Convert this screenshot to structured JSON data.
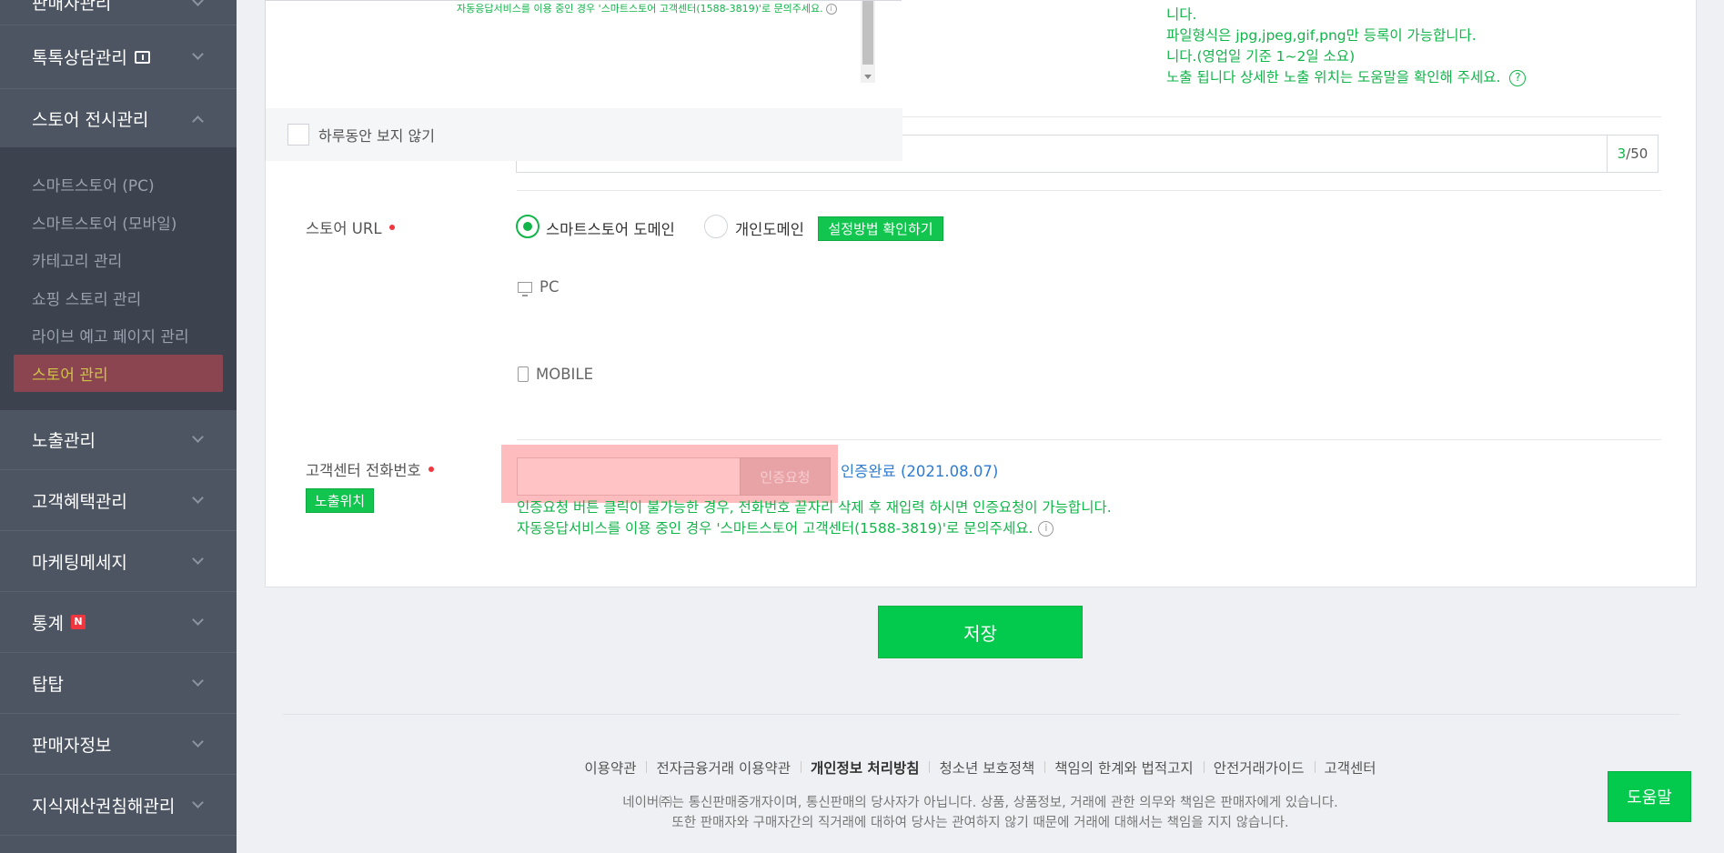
{
  "sidebar": {
    "top_partial": "판매자관리",
    "items": [
      {
        "label": "톡톡상담관리",
        "expanded": false
      },
      {
        "label": "스토어 전시관리",
        "expanded": true
      },
      {
        "label": "노출관리",
        "expanded": false
      },
      {
        "label": "고객혜택관리",
        "expanded": false
      },
      {
        "label": "마케팅메세지",
        "expanded": false
      },
      {
        "label": "통계",
        "badge": "N",
        "expanded": false
      },
      {
        "label": "탑탑",
        "expanded": false
      },
      {
        "label": "판매자정보",
        "expanded": false
      },
      {
        "label": "지식재산권침해관리",
        "expanded": false
      }
    ],
    "sub_items": [
      "스마트스토어 (PC)",
      "스마트스토어 (모바일)",
      "카테고리 관리",
      "쇼핑 스토리 관리",
      "라이브 예고 페이지 관리",
      "스토어 관리"
    ]
  },
  "popup": {
    "notice": "자동응답서비스를 이용 중인 경우 '스마트스토어 고객센터(1588-3819)'로 문의주세요.",
    "dont_show_today": "하루동안 보지 않기"
  },
  "image_help": {
    "line1": "니다.",
    "line2": "파일형식은 jpg,jpeg,gif,png만 등록이 가능합니다.",
    "line3": "니다.(영업일 기준 1~2일 소요)",
    "line4": "노출 됩니다 상세한 노출 위치는 도움말을 확인해 주세요."
  },
  "store_name": {
    "count_current": "3",
    "count_max": "/50"
  },
  "store_url": {
    "label": "스토어 URL",
    "option_smartstore": "스마트스토어 도메인",
    "option_personal": "개인도메인",
    "setup_guide_button": "설정방법 확인하기",
    "pc_label": "PC",
    "mobile_label": "MOBILE"
  },
  "customer_phone": {
    "label": "고객센터 전화번호",
    "exposure_button": "노출위치",
    "request_button": "인증요청",
    "verified_text": "인증완료 (2021.08.07)",
    "note1": "인증요청 버튼 클릭이 불가능한 경우, 전화번호 끝자리 삭제 후 재입력 하시면 인증요청이 가능합니다.",
    "note2": "자동응답서비스를 이용 중인 경우 '스마트스토어 고객센터(1588-3819)'로 문의주세요."
  },
  "save_button": "저장",
  "help_button": "도움말",
  "footer": {
    "links": [
      "이용약관",
      "전자금융거래 이용약관",
      "개인정보 처리방침",
      "청소년 보호정책",
      "책임의 한계와 법적고지",
      "안전거래가이드",
      "고객센터"
    ],
    "text1": "네이버㈜는 통신판매중개자이며, 통신판매의 당사자가 아닙니다. 상품, 상품정보, 거래에 관한 의무와 책임은 판매자에게 있습니다.",
    "text2": "또한 판매자와 구매자간의 직거래에 대하여 당사는 관여하지 않기 때문에 거래에 대해서는 책임을 지지 않습니다."
  },
  "colors": {
    "accent_green": "#03c94c",
    "sidebar_bg": "#4d5563",
    "active_item_bg": "#8a4550",
    "highlight_red": "#ffbcbf"
  }
}
